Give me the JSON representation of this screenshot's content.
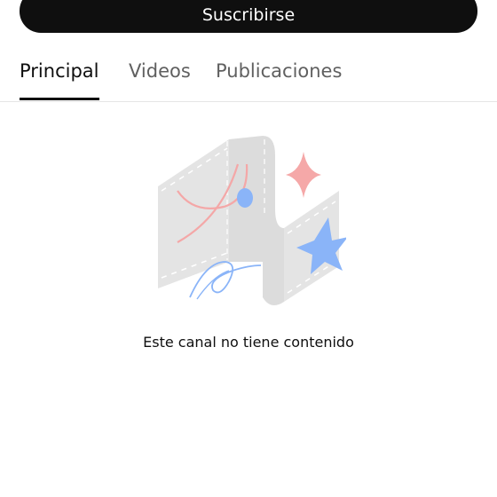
{
  "subscribe": {
    "label": "Suscribirse"
  },
  "tabs": [
    {
      "label": "Principal",
      "active": true
    },
    {
      "label": "Videos",
      "active": false
    },
    {
      "label": "Publicaciones",
      "active": false
    }
  ],
  "empty_state": {
    "illustration_icon": "empty-channel-illustration-icon",
    "message": "Este canal no tiene contenido"
  },
  "colors": {
    "button_bg": "#0f0f0f",
    "button_text": "#ffffff",
    "tab_active": "#0f0f0f",
    "tab_inactive": "#606060",
    "divider": "#e5e5e5",
    "illustration_gray": "#e3e3e3",
    "illustration_red": "#f5a8a8",
    "illustration_blue": "#8ab4f8"
  }
}
